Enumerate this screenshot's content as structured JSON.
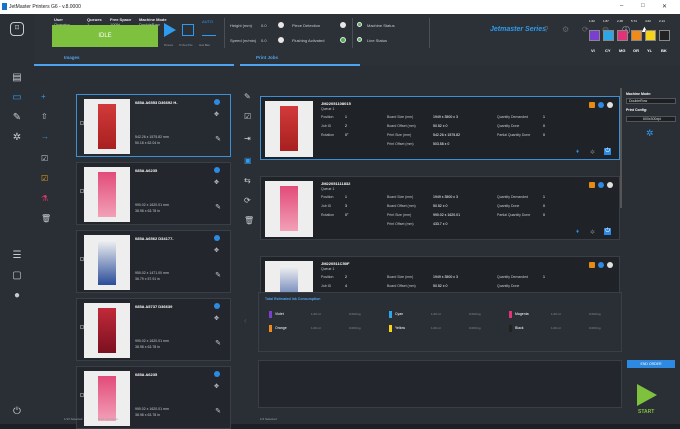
{
  "window": {
    "title": "JetMaster Printers G6 - v.8.0000"
  },
  "header": {
    "user_label": "User",
    "user_value": "Operator",
    "queues_label": "Queues",
    "queues_value": "1",
    "free_space_label": "Free Space",
    "free_space_value": "100%",
    "machine_mode_label": "Machine Mode",
    "machine_mode_value": "DoubleRow",
    "status": "IDLE",
    "tb_labels": [
      "Process",
      "To Next Pos",
      "Auto Bias"
    ],
    "auto_label": "AUTO",
    "height_label": "Height (mm)",
    "height_value": "0.0",
    "speed_label": "Speed (m/min)",
    "speed_value": "0.0",
    "piece_detection": "Piece Detection",
    "flushing": "Flushing Activated",
    "machine_status": "Machine Status",
    "line_status": "Line Status",
    "brand": "Jetmaster Series"
  },
  "inks": [
    {
      "code": "VI",
      "level": "1.62",
      "color": "#7a3fd1"
    },
    {
      "code": "CY",
      "level": "1.87",
      "color": "#2ba6e8"
    },
    {
      "code": "MG",
      "level": "2.48",
      "color": "#e0337a"
    },
    {
      "code": "OR",
      "level": "5.74",
      "color": "#f08a1a"
    },
    {
      "code": "YL",
      "level": "4.62",
      "color": "#f4d31a"
    },
    {
      "code": "BK",
      "level": "2.14",
      "color": "#222222"
    }
  ],
  "tabs": {
    "images": "Images",
    "print_jobs": "Print Jobs"
  },
  "images": [
    {
      "title": "085A A6553 D36692 H-",
      "size1": "542.26 x 1575.82 mm",
      "size2": "50.18 x 62.04 in",
      "selected": true
    },
    {
      "title": "085A A6235",
      "size1": "990.02 x 1620.01 mm",
      "size2": "38.98 x 63.78 in",
      "selected": false
    },
    {
      "title": "085A A6562 D34177-",
      "size1": "950.02 x 1471.00 mm",
      "size2": "36.79 x 57.91 in",
      "selected": false
    },
    {
      "title": "085A A5737 D36639",
      "size1": "990.02 x 1620.01 mm",
      "size2": "38.98 x 63.78 in",
      "selected": false
    },
    {
      "title": "085A A6235",
      "size1": "990.02 x 1620.01 mm",
      "size2": "38.98 x 63.78 in",
      "selected": false
    }
  ],
  "images_footer": {
    "selected": "1/10 Selected",
    "uploaded": "6/10 Uploaded"
  },
  "jobs": [
    {
      "name": "JM22051108015",
      "queue": "Queue 1",
      "position": "1",
      "job_id": "2",
      "rotation": "0°",
      "board_size": "1949 x 3500 x 3",
      "board_offset": "50.52 x 0",
      "print_size": "542.26 x 1575.82",
      "print_offset": "503.58 x 0",
      "qty_demanded": "1",
      "qty_done": "0",
      "partial_done": "0",
      "selected": true
    },
    {
      "name": "JM22051111832",
      "queue": "Queue 1",
      "position": "1",
      "job_id": "3",
      "rotation": "0°",
      "board_size": "1949 x 3500 x 3",
      "board_offset": "50.52 x 0",
      "print_size": "990.02 x 1620.01",
      "print_offset": "433.7 x 0",
      "qty_demanded": "1",
      "qty_done": "0",
      "partial_done": "0",
      "selected": false
    },
    {
      "name": "JM220511C50F",
      "queue": "Queue 1",
      "position": "2",
      "job_id": "4",
      "rotation": "",
      "board_size": "1949 x 3500 x 3",
      "board_offset": "50.52 x 0",
      "print_size": "",
      "print_offset": "",
      "qty_demanded": "1",
      "qty_done": "",
      "partial_done": "",
      "selected": false
    }
  ],
  "job_labels": {
    "position": "Position",
    "job_id": "Job ID",
    "rotation": "Rotation",
    "board_size": "Board Size (mm)",
    "board_offset": "Board Offset (mm)",
    "print_size": "Print Size (mm)",
    "print_offset": "Print Offset (mm)",
    "qty_demanded": "Quantity Demanded",
    "qty_done": "Quantity Done",
    "partial_done": "Partial Quantity Done"
  },
  "consumption": {
    "title": "Total Estimated Ink Consumption",
    "items": [
      {
        "name": "Violet",
        "color": "#7a3fd1",
        "v1": "1.00 ml",
        "v2": "0.000 kg"
      },
      {
        "name": "Cyan",
        "color": "#2ba6e8",
        "v1": "1.00 ml",
        "v2": "0.000 kg"
      },
      {
        "name": "Magenta",
        "color": "#e0337a",
        "v1": "1.00 ml",
        "v2": "0.000 kg"
      },
      {
        "name": "Orange",
        "color": "#f08a1a",
        "v1": "1.00 ml",
        "v2": "0.000 kg"
      },
      {
        "name": "Yellow",
        "color": "#f4d31a",
        "v1": "1.00 ml",
        "v2": "0.000 kg"
      },
      {
        "name": "Black",
        "color": "#222222",
        "v1": "1.00 ml",
        "v2": "0.000 kg"
      }
    ]
  },
  "jobs_footer": {
    "selected": "1/4 Selected"
  },
  "right": {
    "mode_label": "Machine Mode:",
    "mode_value": "DoubleRow",
    "config_label": "Print Config:",
    "config_value": "600x300dpi",
    "end_order": "END ORDER",
    "start": "START"
  }
}
